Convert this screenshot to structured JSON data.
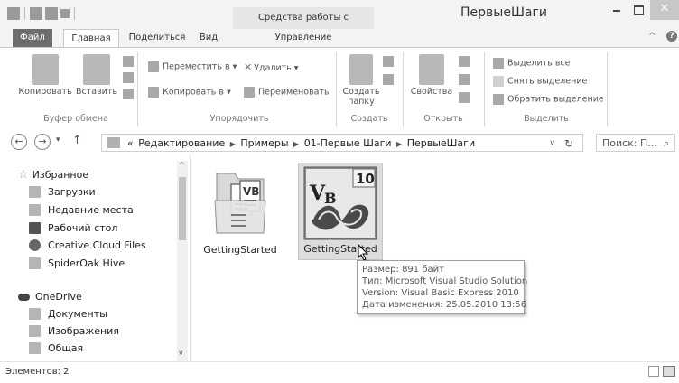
{
  "window": {
    "title": "ПервыеШаги",
    "context_tab": "Средства работы с рисунками",
    "context_subtab": "Управление"
  },
  "tabs": {
    "file": "Файл",
    "home": "Главная",
    "share": "Поделиться",
    "view": "Вид",
    "manage": "Управление"
  },
  "ribbon": {
    "clipboard": {
      "label": "Буфер обмена",
      "copy": "Копировать",
      "paste": "Вставить"
    },
    "organize": {
      "label": "Упорядочить",
      "move_to": "Переместить в ▾",
      "copy_to": "Копировать в ▾",
      "delete": "Удалить ▾",
      "rename": "Переименовать"
    },
    "new": {
      "label": "Создать",
      "new_folder_line1": "Создать",
      "new_folder_line2": "папку"
    },
    "open": {
      "label": "Открыть",
      "properties": "Свойства"
    },
    "select": {
      "label": "Выделить",
      "select_all": "Выделить все",
      "select_none": "Снять выделение",
      "invert": "Обратить выделение"
    }
  },
  "address": {
    "breadcrumb": [
      "«",
      "Редактирование",
      "Примеры",
      "01-Первые Шаги",
      "ПервыеШаги"
    ],
    "search_placeholder": "Поиск: П..."
  },
  "sidebar": {
    "favorites_label": "Избранное",
    "favorites": [
      "Загрузки",
      "Недавние места",
      "Рабочий стол",
      "Creative Cloud Files",
      "SpiderOak Hive"
    ],
    "onedrive_label": "OneDrive",
    "onedrive": [
      "Документы",
      "Изображения",
      "Общая"
    ]
  },
  "files": [
    {
      "name": "GettingStarted",
      "type": "folder"
    },
    {
      "name": "GettingStarted",
      "type": "vb-solution",
      "badge": "10"
    }
  ],
  "tooltip": {
    "size": "Размер: 891 байт",
    "type": "Тип: Microsoft Visual Studio Solution",
    "version": "Version: Visual Basic Express 2010",
    "modified": "Дата изменения: 25.05.2010 13:56"
  },
  "status": {
    "items": "Элементов: 2"
  },
  "colors": {
    "file_tab": "#6d6d6d",
    "close_button": "#c7c7c7",
    "selection": "#dcdcdc",
    "vb_purple": "#5c3f7a"
  }
}
